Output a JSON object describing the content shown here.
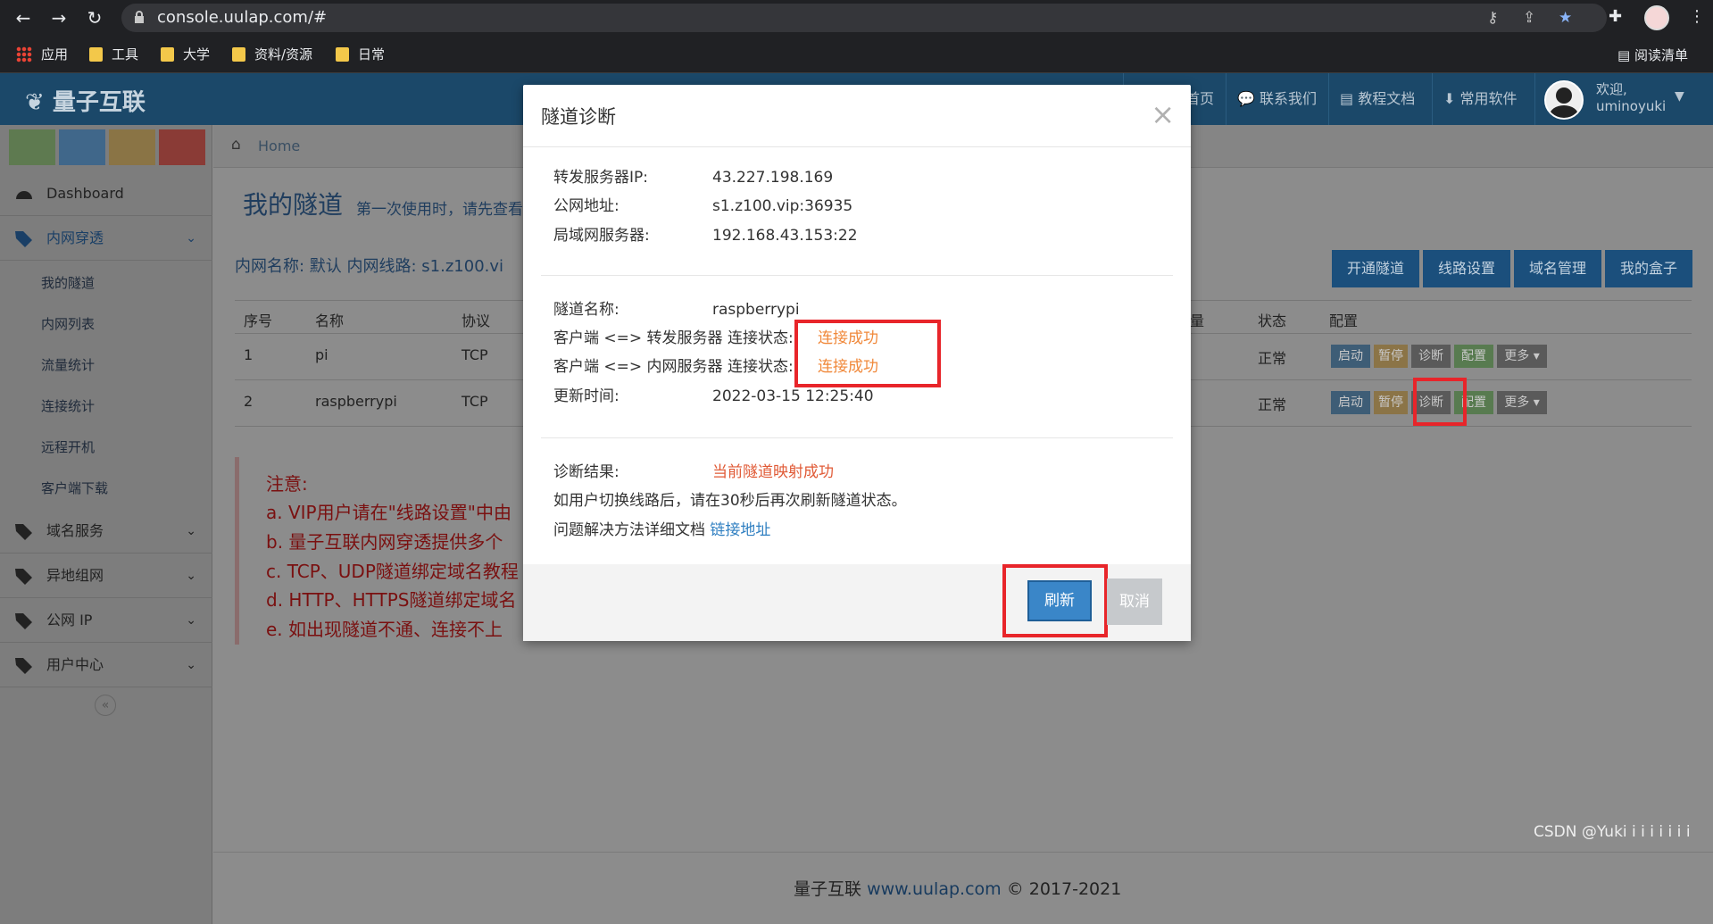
{
  "browser": {
    "url": "console.uulap.com/#",
    "bookmarks": [
      "应用",
      "工具",
      "大学",
      "资料/资源",
      "日常"
    ],
    "reading_list": "阅读清单"
  },
  "header": {
    "brand": "量子互联",
    "nav": [
      "首页",
      "联系我们",
      "教程文档",
      "常用软件"
    ],
    "welcome": "欢迎,",
    "username": "uminoyuki"
  },
  "sidebar": {
    "dashboard": "Dashboard",
    "sections": [
      {
        "label": "内网穿透",
        "expanded": true
      },
      {
        "label": "域名服务"
      },
      {
        "label": "异地组网"
      },
      {
        "label": "公网 IP"
      },
      {
        "label": "用户中心"
      }
    ],
    "subitems": [
      "我的隧道",
      "内网列表",
      "流量统计",
      "连接统计",
      "远程开机",
      "客户端下载"
    ],
    "collapse_icon": "«"
  },
  "main": {
    "breadcrumb": "Home",
    "title": "我的隧道",
    "subtitle": "第一次使用时，请先查看",
    "info": "内网名称: 默认   内网线路: s1.z100.vi",
    "actions": [
      "开通隧道",
      "线路设置",
      "域名管理",
      "我的盒子"
    ],
    "table": {
      "headers": [
        "序号",
        "名称",
        "协议",
        "量",
        "状态",
        "配置"
      ],
      "rows": [
        {
          "no": "1",
          "name": "pi",
          "proto": "TCP",
          "status": "正常"
        },
        {
          "no": "2",
          "name": "raspberrypi",
          "proto": "TCP",
          "status": "正常"
        }
      ],
      "row_buttons": [
        "启动",
        "暂停",
        "诊断",
        "配置",
        "更多"
      ]
    },
    "notes": [
      "注意:",
      "a. VIP用户请在\"线路设置\"中由",
      "b. 量子互联内网穿透提供多个",
      "c. TCP、UDP隧道绑定域名教程",
      "d. HTTP、HTTPS隧道绑定域名",
      "e. 如出现隧道不通、连接不上"
    ],
    "footer": {
      "brand": "量子互联",
      "site": "www.uulap.com",
      "copy": "© 2017-2021"
    }
  },
  "modal": {
    "title": "隧道诊断",
    "close": "×",
    "section1": [
      {
        "k": "转发服务器IP:",
        "v": "43.227.198.169"
      },
      {
        "k": "公网地址:",
        "v": "s1.z100.vip:36935"
      },
      {
        "k": "局域网服务器:",
        "v": "192.168.43.153:22"
      }
    ],
    "tunnel_name_label": "隧道名称:",
    "tunnel_name": "raspberrypi",
    "client_forward_label": "客户端 <=> 转发服务器 连接状态:",
    "client_forward_status": "连接成功",
    "client_lan_label": "客户端 <=> 内网服务器 连接状态:",
    "client_lan_status": "连接成功",
    "update_label": "更新时间:",
    "update_time": "2022-03-15 12:25:40",
    "result_label": "诊断结果:",
    "result_value": "当前隧道映射成功",
    "tip": "如用户切换线路后，请在30秒后再次刷新隧道状态。",
    "doc_label": "问题解决方法详细文档",
    "doc_link": "链接地址",
    "refresh": "刷新",
    "cancel": "取消"
  },
  "watermark": "CSDN @Yuki i i i i i i i"
}
